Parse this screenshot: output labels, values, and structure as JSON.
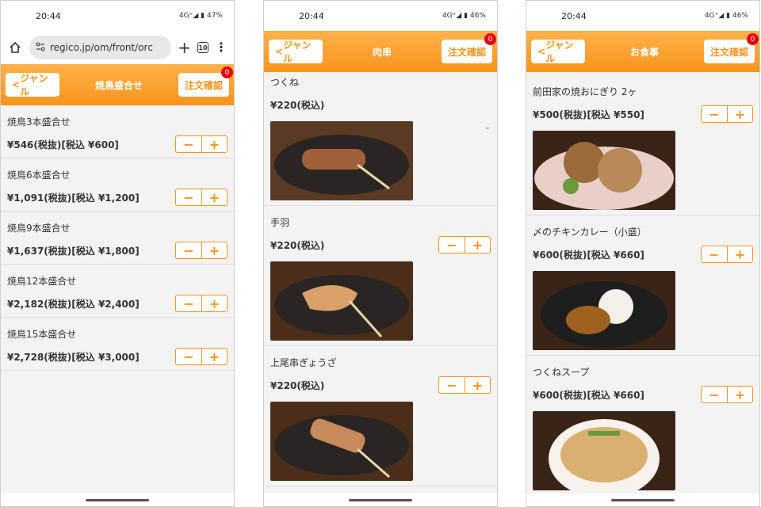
{
  "screens": [
    {
      "status": {
        "time": "20:44",
        "signal": "4G⁺◢ ▮ 47%"
      },
      "url": "regico.jp/om/front/orc",
      "tab_count": "10",
      "header": {
        "back": "ジャンル",
        "title": "焼鳥盛合せ",
        "cart": "注文確認",
        "cart_count": "0"
      },
      "items": [
        {
          "name": "焼鳥3本盛合せ",
          "price": "¥546(税抜)[税込 ¥600]"
        },
        {
          "name": "焼鳥6本盛合せ",
          "price": "¥1,091(税抜)[税込 ¥1,200]"
        },
        {
          "name": "焼鳥9本盛合せ",
          "price": "¥1,637(税抜)[税込 ¥1,800]"
        },
        {
          "name": "焼鳥12本盛合せ",
          "price": "¥2,182(税抜)[税込 ¥2,400]"
        },
        {
          "name": "焼鳥15本盛合せ",
          "price": "¥2,728(税抜)[税込 ¥3,000]"
        }
      ]
    },
    {
      "status": {
        "time": "20:44",
        "signal": "4G⁺◢ ▮ 46%"
      },
      "header": {
        "back": "ジャンル",
        "title": "肉串",
        "cart": "注文確認",
        "cart_count": "0"
      },
      "items": [
        {
          "name": "つくね",
          "price": "¥220(税込)"
        },
        {
          "name": "手羽",
          "price": "¥220(税込)"
        },
        {
          "name": "上尾串ぎょうざ",
          "price": "¥220(税込)"
        }
      ]
    },
    {
      "status": {
        "time": "20:44",
        "signal": "4G⁺◢ ▮ 46%"
      },
      "header": {
        "back": "ジャンル",
        "title": "お食事",
        "cart": "注文確認",
        "cart_count": "0"
      },
      "items": [
        {
          "name": "前田家の焼おにぎり 2ヶ",
          "price": "¥500(税抜)[税込 ¥550]"
        },
        {
          "name": "〆のチキンカレー（小盛）",
          "price": "¥600(税抜)[税込 ¥660]"
        },
        {
          "name": "つくねスープ",
          "price": "¥600(税抜)[税込 ¥660]"
        }
      ]
    }
  ],
  "colors": {
    "accent": "#f7941d",
    "badge": "#e60012"
  },
  "icons": [
    "home-icon",
    "site-settings-icon",
    "new-tab-icon",
    "tab-switcher-icon",
    "menu-icon",
    "minus-icon",
    "plus-icon",
    "chevron-left-icon",
    "chevron-down-icon"
  ]
}
